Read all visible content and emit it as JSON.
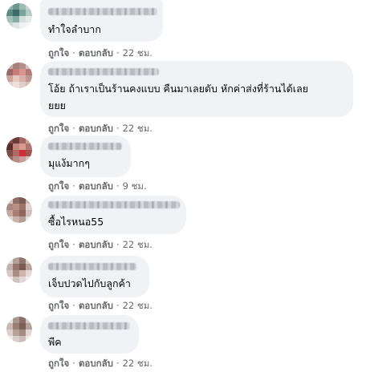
{
  "actions": {
    "like": "ถูกใจ",
    "reply": "ตอบกลับ",
    "separator": "·"
  },
  "comments": [
    {
      "text": "ทำใจลำบาก",
      "time": "22 ชม."
    },
    {
      "text": "โอ้ย ถ้าเราเป็นร้านคงแบบ คืนมาเลยดับ หักค่าส่งที่ร้านได้เลย",
      "text2": "ยยย",
      "time": "22 ชม."
    },
    {
      "text": "มุแง้มากๆ",
      "time": "9 ชม."
    },
    {
      "text": "ซื้อไรหนอ55",
      "time": "22 ชม."
    },
    {
      "text": "เจ็บปวดไปกับลูกค้า",
      "time": "22 ชม."
    },
    {
      "text": "พีค",
      "time": "22 ชม."
    }
  ]
}
